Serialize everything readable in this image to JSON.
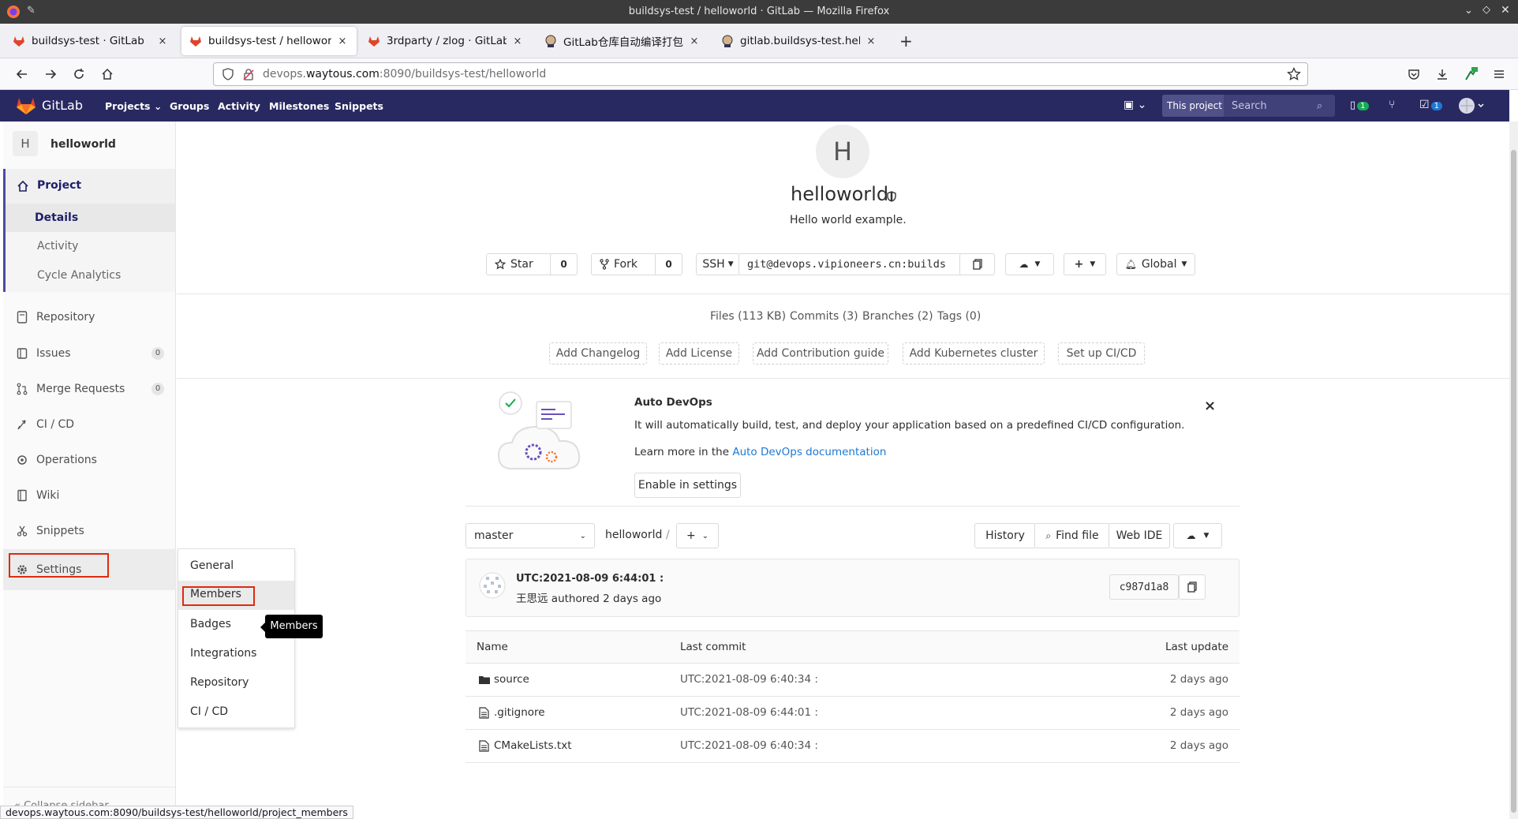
{
  "window": {
    "title": "buildsys-test / helloworld · GitLab — Mozilla Firefox"
  },
  "tabs": [
    {
      "label": "buildsys-test · GitLab",
      "close": "×"
    },
    {
      "label": "buildsys-test / helloworld ·",
      "close": "×"
    },
    {
      "label": "3rdparty / zlog · GitLab",
      "close": "×"
    },
    {
      "label": "GitLab仓库自动编译打包 [Je",
      "close": "×"
    },
    {
      "label": "gitlab.buildsys-test.hellow",
      "close": "×"
    }
  ],
  "new_tab": "+",
  "url": {
    "host_prefix": "devops.",
    "domain": "waytous.com",
    "rest": ":8090/buildsys-test/helloworld"
  },
  "gitlab_nav": {
    "brand": "GitLab",
    "items": [
      "Projects ⌄",
      "Groups",
      "Activity",
      "Milestones",
      "Snippets"
    ],
    "this_project": "This project",
    "search_placeholder": "Search",
    "issues_count": "1",
    "todos_count": "1"
  },
  "sidebar": {
    "project_avatar": "H",
    "project_name": "helloworld",
    "project_label": "Project",
    "sub_items": [
      "Details",
      "Activity",
      "Cycle Analytics"
    ],
    "items": [
      "Repository",
      "Issues",
      "Merge Requests",
      "CI / CD",
      "Operations",
      "Wiki",
      "Snippets",
      "Settings"
    ],
    "issues_badge": "0",
    "mr_badge": "0",
    "collapse_label": "Collapse sidebar"
  },
  "settings_flyout": [
    "General",
    "Members",
    "Badges",
    "Integrations",
    "Repository",
    "CI / CD"
  ],
  "tooltip": "Members",
  "project": {
    "avatar": "H",
    "name": "helloworld",
    "description": "Hello world example.",
    "star_label": "Star",
    "star_count": "0",
    "fork_label": "Fork",
    "fork_count": "0",
    "protocol": "SSH",
    "clone_url": "git@devops.vipioneers.cn:builds",
    "notification": "Global"
  },
  "stats": [
    "Files (113 KB)",
    "Commits (3)",
    "Branches (2)",
    "Tags (0)"
  ],
  "quick_actions": [
    "Add Changelog",
    "Add License",
    "Add Contribution guide",
    "Add Kubernetes cluster",
    "Set up CI/CD"
  ],
  "autodevops": {
    "title": "Auto DevOps",
    "text": "It will automatically build, test, and deploy your application based on a predefined CI/CD configuration.",
    "learn_prefix": "Learn more in the ",
    "learn_link": "Auto DevOps documentation",
    "button": "Enable in settings",
    "close": "×"
  },
  "repo_toolbar": {
    "branch": "master",
    "path": "helloworld",
    "separator": "/",
    "add": "+",
    "history": "History",
    "find_file": "Find file",
    "web_ide": "Web IDE"
  },
  "last_commit": {
    "title": "UTC:2021-08-09 6:44:01 :",
    "author_line": "王思远 authored 2 days ago",
    "sha": "c987d1a8"
  },
  "file_table": {
    "headers": [
      "Name",
      "Last commit",
      "Last update"
    ],
    "rows": [
      {
        "icon": "folder-icon",
        "name": "source",
        "commit": "UTC:2021-08-09 6:40:34 :",
        "updated": "2 days ago"
      },
      {
        "icon": "file-icon",
        "name": ".gitignore",
        "commit": "UTC:2021-08-09 6:44:01 :",
        "updated": "2 days ago"
      },
      {
        "icon": "file-icon",
        "name": "CMakeLists.txt",
        "commit": "UTC:2021-08-09 6:40:34 :",
        "updated": "2 days ago"
      }
    ]
  },
  "status_url": "devops.waytous.com:8090/buildsys-test/helloworld/project_members",
  "colors": {
    "gitlab_header": "#292961",
    "sidebar_active": "#1f1f6b",
    "highlight_box": "#dd2b0e",
    "link": "#1f78d1"
  }
}
